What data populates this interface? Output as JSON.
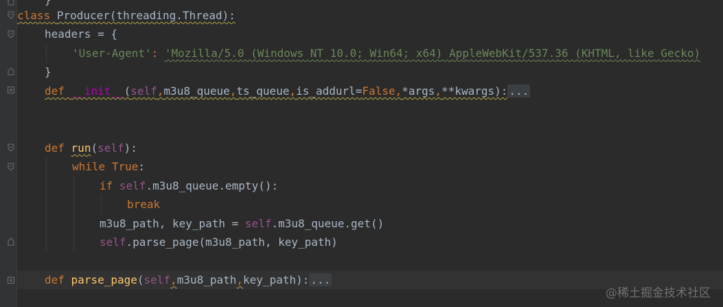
{
  "code": {
    "l0": {
      "brace": "}"
    },
    "l1": {
      "kw": "class",
      "name": "Producer",
      "rest": "(threading.Thread):"
    },
    "l2": {
      "text": "headers = {"
    },
    "l3": {
      "key": "'User-Agent'",
      "colon": ": ",
      "value": "'Mozilla/5.0 (Windows NT 10.0; Win64; x64) AppleWebKit/537.36 (KHTML, like Gecko)"
    },
    "l4": {
      "text": "}"
    },
    "l5": {
      "kw": "def",
      "name": "__init__",
      "open": "(",
      "self": "self",
      "c1": ",",
      "p1": "m3u8_queue",
      "c2": ",",
      "p2": "ts_queue",
      "c3": ",",
      "p3": "is_addurl=",
      "false": "False",
      "c4": ",",
      "p4": "*args",
      "c5": ",",
      "p5": "**kwargs",
      "close": "):",
      "fold": "..."
    },
    "l8": {
      "kw": "def",
      "name": "run",
      "open": "(",
      "self": "self",
      "close": "):"
    },
    "l9": {
      "kw": "while",
      "true": "True",
      "colon": ":"
    },
    "l10": {
      "kw": "if",
      "self": "self",
      "rest": ".m3u8_queue.empty():"
    },
    "l11": {
      "kw": "break"
    },
    "l12": {
      "a": "m3u8_path, key_path = ",
      "self": "self",
      "b": ".m3u8_queue.get()"
    },
    "l13": {
      "self": "self",
      "rest": ".parse_page(m3u8_path, key_path)"
    },
    "l15": {
      "kw": "def",
      "name": "parse_page",
      "open": "(",
      "self": "self",
      "c1": ",",
      "p1": "m3u8_path",
      "c2": ",",
      "p2": "key_path",
      "close": "):",
      "fold": "..."
    }
  },
  "watermark": "@稀土掘金技术社区"
}
